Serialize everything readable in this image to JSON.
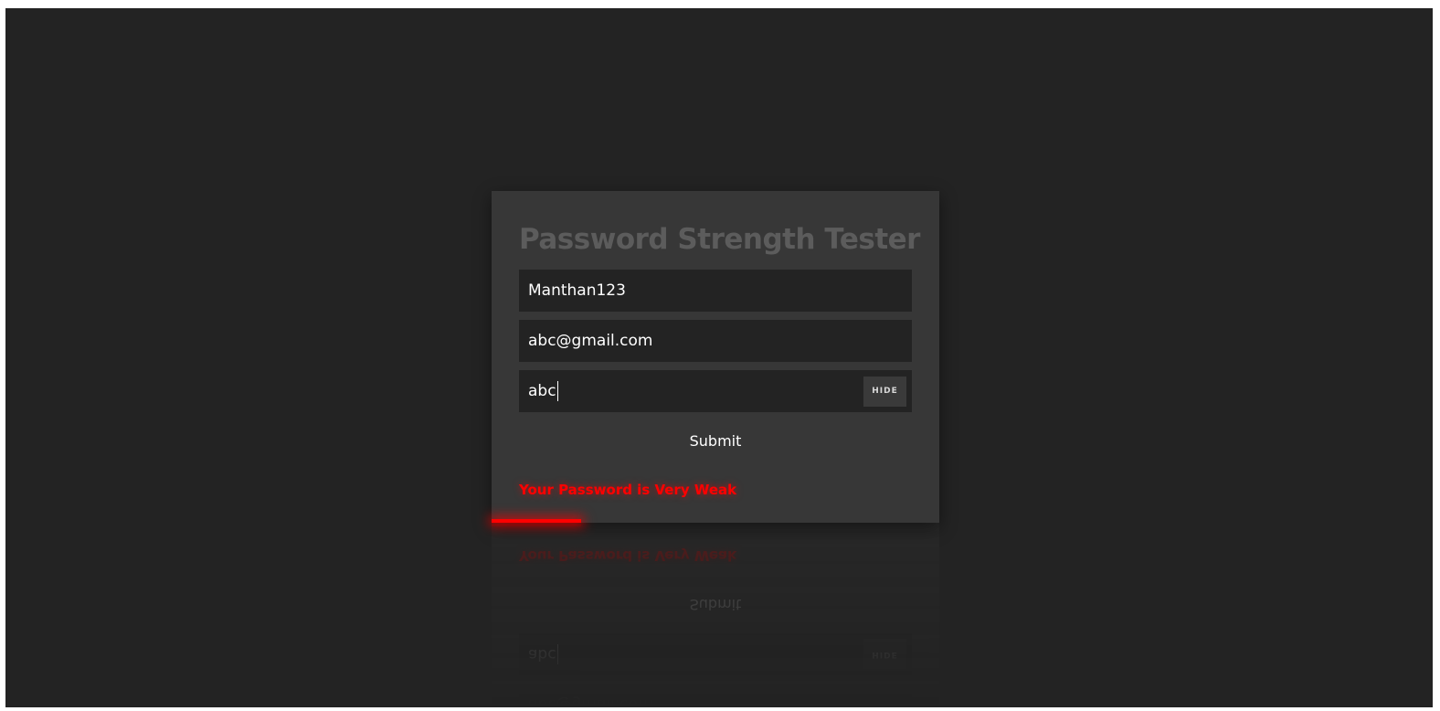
{
  "form": {
    "title": "Password Strength Tester",
    "username_value": "Manthan123",
    "email_value": "abc@gmail.com",
    "password_value": "abc",
    "toggle_label": "HIDE",
    "submit_label": "Submit"
  },
  "strength": {
    "message": "Your Password is Very Weak",
    "level": 0.2,
    "color": "#ff0000"
  }
}
